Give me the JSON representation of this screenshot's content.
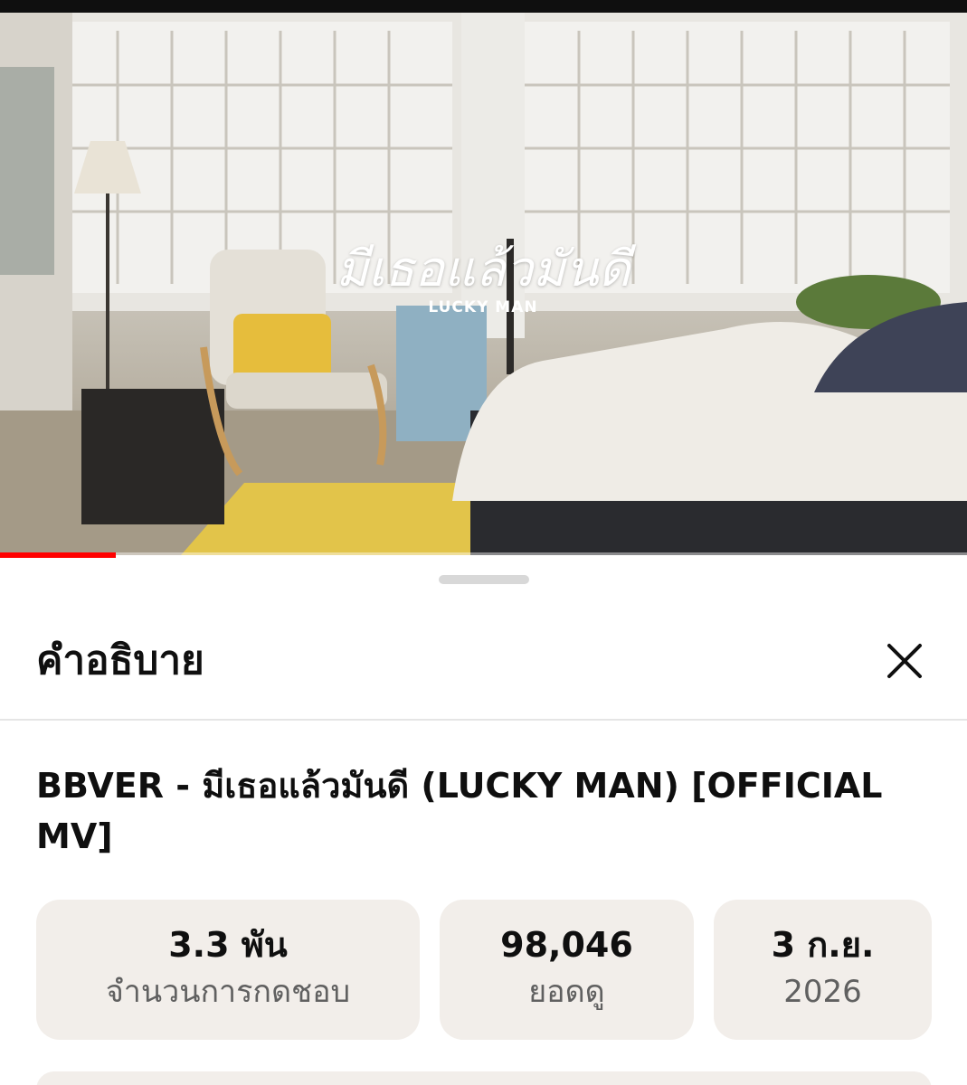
{
  "video": {
    "overlay_title_thai": "มีเธอแล้วมันดี",
    "overlay_title_en": "LUCKY MAN",
    "progress_fraction": 0.12,
    "progress_color": "#ff0000"
  },
  "sheet": {
    "title": "คำอธิบาย",
    "close_icon": "close-icon",
    "video_title": "BBVER - มีเธอแล้วมันดี (LUCKY MAN) [OFFICIAL MV]",
    "stats": {
      "likes": {
        "value": "3.3 พัน",
        "label": "จำนวนการกดชอบ"
      },
      "views": {
        "value": "98,046",
        "label": "ยอดดู"
      },
      "date": {
        "value": "3 ก.ย.",
        "label": "2026"
      }
    }
  }
}
